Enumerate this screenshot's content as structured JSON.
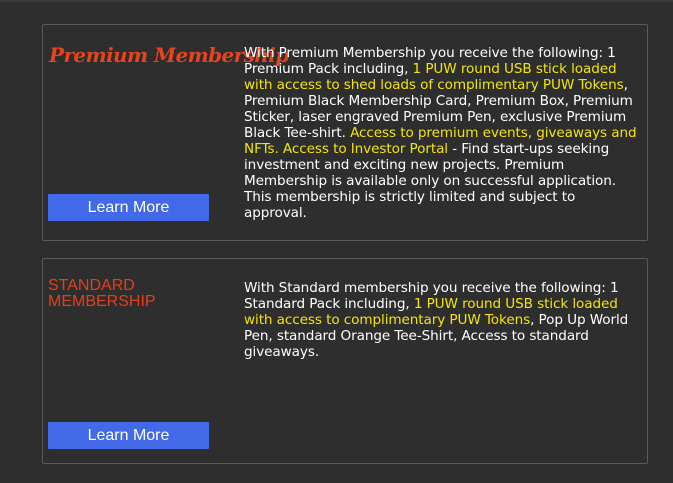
{
  "premium": {
    "title": "Premium Membership",
    "desc": [
      {
        "text": "With Premium Membership you receive the following: 1 Premium Pack including, ",
        "hl": false
      },
      {
        "text": "1 PUW round USB stick loaded with access to shed loads of complimentary PUW Tokens",
        "hl": true
      },
      {
        "text": ", Premium Black Membership Card, Premium Box, Premium Sticker, laser engraved Premium Pen, exclusive Premium Black Tee-shirt. ",
        "hl": false
      },
      {
        "text": "Access to premium events, giveaways and NFTs. Access to Investor Portal",
        "hl": true
      },
      {
        "text": " - Find start-ups seeking investment and exciting new projects. Premium Membership is available only on successful application. This membership is strictly limited and subject to approval.",
        "hl": false
      }
    ],
    "button_label": "Learn More"
  },
  "standard": {
    "title": "Standard Membership",
    "desc": [
      {
        "text": "With Standard membership you receive the following: 1 Standard Pack including, ",
        "hl": false
      },
      {
        "text": "1 PUW round USB stick loaded with access to complimentary PUW Tokens",
        "hl": true
      },
      {
        "text": ",  Pop Up World Pen, standard Orange Tee-Shirt, Access to standard giveaways.",
        "hl": false
      }
    ],
    "button_label": "Learn More"
  },
  "colors": {
    "background": "#2e2e2e",
    "title_accent": "#e8431c",
    "highlight": "#f2e40b",
    "button": "#4169e8"
  }
}
